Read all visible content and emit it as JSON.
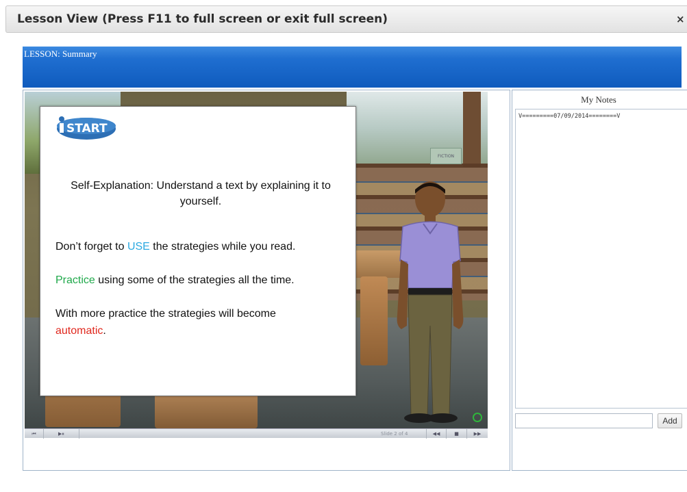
{
  "window": {
    "title": "Lesson View (Press F11 to full screen or exit full screen)",
    "close_glyph": "×"
  },
  "lesson": {
    "header_label": "LESSON: Summary"
  },
  "slide": {
    "logo_text": "START",
    "heading": "Self-Explanation: Understand a text by explaining it to yourself.",
    "line1_pre": "Don’t forget to ",
    "line1_highlight": "USE",
    "line1_post": " the strategies while you read.",
    "line2_highlight": "Practice",
    "line2_post": " using some of the strategies all the time.",
    "line3_pre": "With more practice the strategies will become ",
    "line3_highlight": "automatic",
    "line3_post": ".",
    "colors": {
      "use": "#2aa8e0",
      "practice": "#1fa84a",
      "automatic": "#e0281e"
    }
  },
  "player": {
    "btn_start": "⏮",
    "btn_playpause": "▶⏸",
    "slide_counter": "Slide 2 of 4",
    "btn_prev": "◀◀",
    "btn_stop": "■",
    "btn_next": "▶▶",
    "scene_sign": "FICTION"
  },
  "notes": {
    "heading": "My Notes",
    "content": "V=========07/09/2014========V",
    "input_value": "",
    "add_label": "Add"
  },
  "icons": {
    "close": "close-icon",
    "logo": "istart-logo",
    "status": "status-indicator-icon"
  }
}
